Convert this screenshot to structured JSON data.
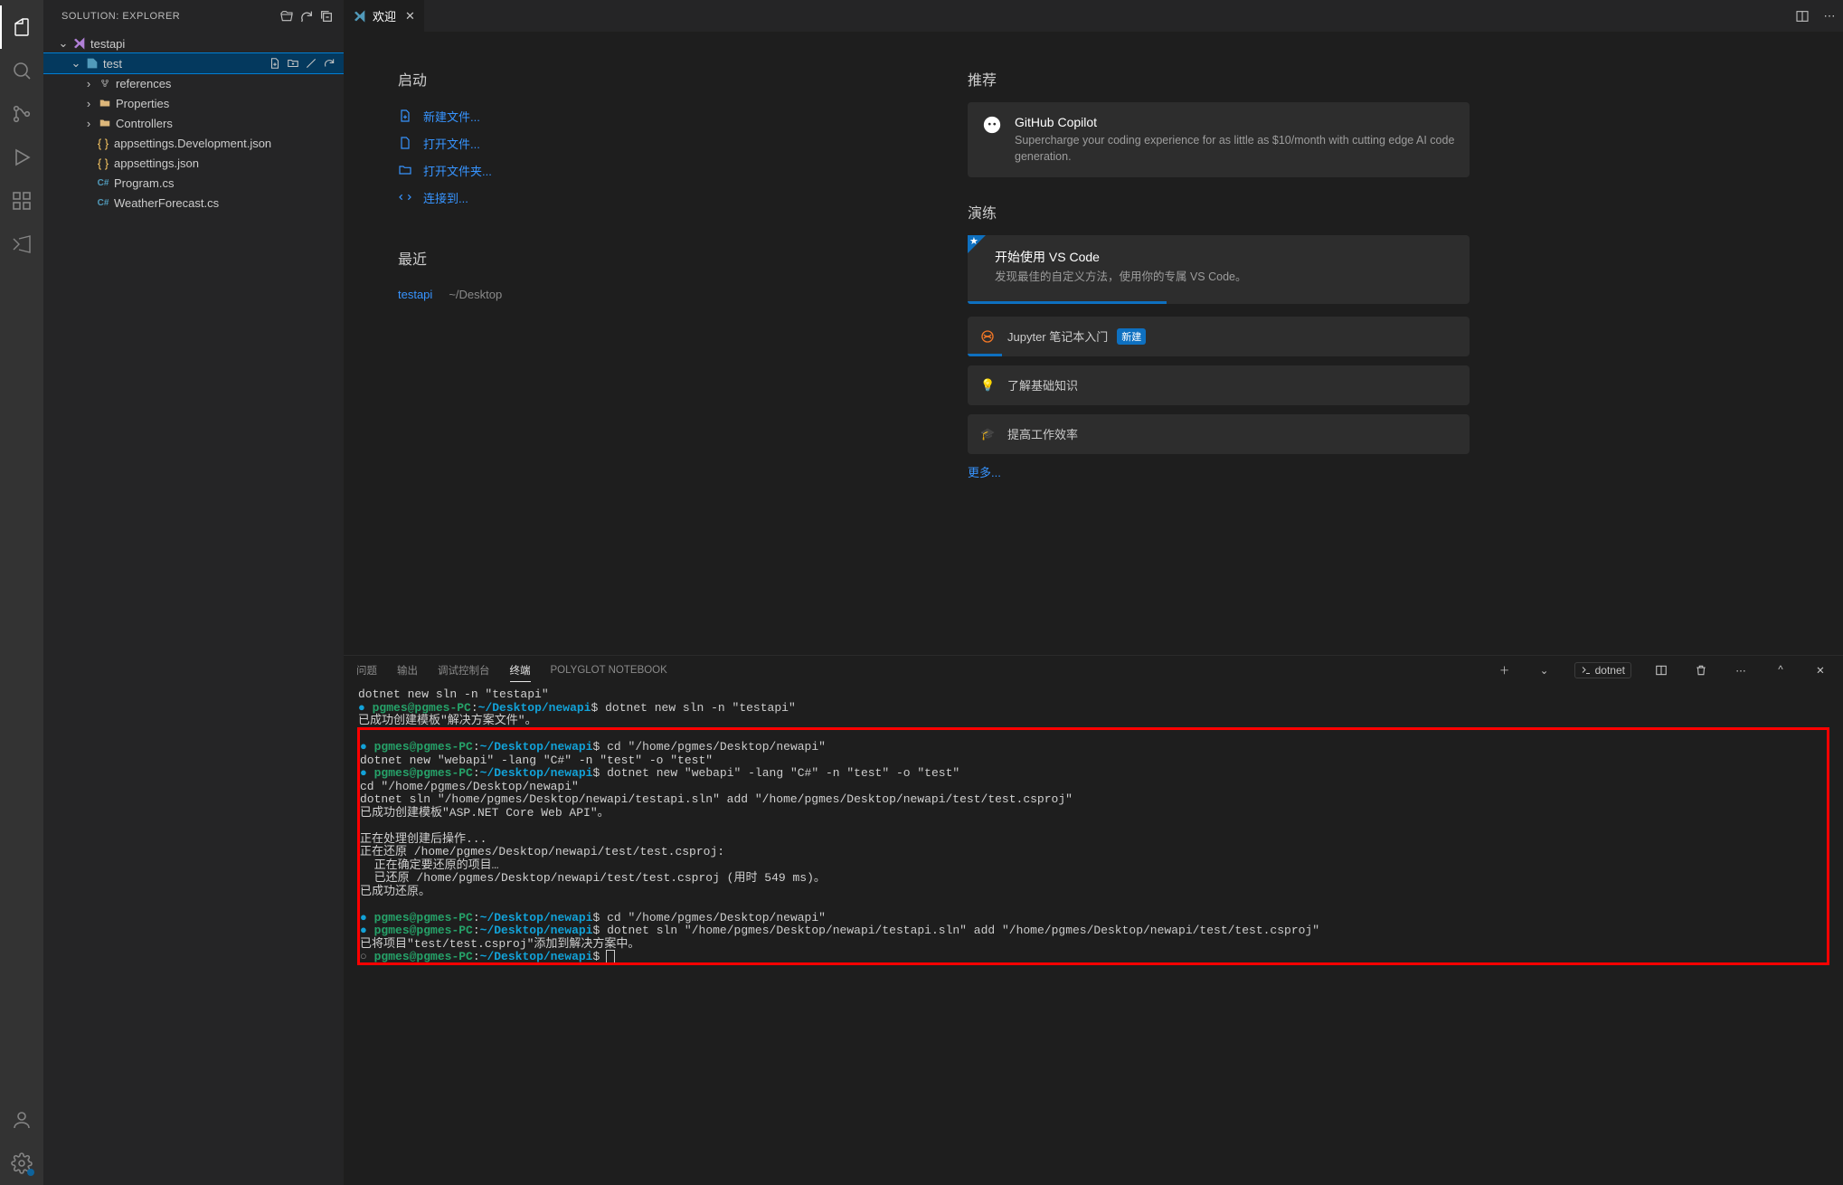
{
  "sidebar": {
    "title": "SOLUTION: EXPLORER",
    "root": "testapi",
    "project": "test",
    "items": [
      {
        "label": "references"
      },
      {
        "label": "Properties"
      },
      {
        "label": "Controllers"
      },
      {
        "label": "appsettings.Development.json"
      },
      {
        "label": "appsettings.json"
      },
      {
        "label": "Program.cs"
      },
      {
        "label": "WeatherForecast.cs"
      }
    ]
  },
  "tab": {
    "label": "欢迎"
  },
  "welcome": {
    "start_h": "启动",
    "start_links": [
      {
        "label": "新建文件..."
      },
      {
        "label": "打开文件..."
      },
      {
        "label": "打开文件夹..."
      },
      {
        "label": "连接到..."
      }
    ],
    "recent_h": "最近",
    "recent": {
      "name": "testapi",
      "path": "~/Desktop"
    },
    "recommend_h": "推荐",
    "copilot": {
      "title": "GitHub Copilot",
      "desc": "Supercharge your coding experience for as little as $10/month with cutting edge AI code generation."
    },
    "walk_h": "演练",
    "walk1": {
      "title": "开始使用 VS Code",
      "desc": "发现最佳的自定义方法，使用你的专属 VS Code。"
    },
    "walk2": {
      "label": "Jupyter 笔记本入门",
      "badge": "新建"
    },
    "walk3": {
      "label": "了解基础知识"
    },
    "walk4": {
      "label": "提高工作效率"
    },
    "more": "更多..."
  },
  "panel": {
    "tabs": [
      "问题",
      "输出",
      "调试控制台",
      "终端",
      "POLYGLOT NOTEBOOK"
    ],
    "profile": "dotnet"
  },
  "terminal": {
    "prompt_user": "pgmes@pgmes-PC",
    "prompt_sep": ":",
    "prompt_path": "~/Desktop/newapi",
    "prompt_end": "$",
    "l0": "dotnet new sln -n \"testapi\"",
    "cmd1": "dotnet new sln -n \"testapi\"",
    "l2": "已成功创建模板\"解决方案文件\"。",
    "cmd2": "cd \"/home/pgmes/Desktop/newapi\"",
    "l4": "dotnet new \"webapi\" -lang \"C#\" -n \"test\" -o \"test\"",
    "cmd3": "dotnet new \"webapi\" -lang \"C#\" -n \"test\" -o \"test\"",
    "l6": "cd \"/home/pgmes/Desktop/newapi\"",
    "l7": "dotnet sln \"/home/pgmes/Desktop/newapi/testapi.sln\" add \"/home/pgmes/Desktop/newapi/test/test.csproj\"",
    "l8": "已成功创建模板\"ASP.NET Core Web API\"。",
    "l9": "正在处理创建后操作...",
    "l10": "正在还原 /home/pgmes/Desktop/newapi/test/test.csproj:",
    "l11": "  正在确定要还原的项目…",
    "l12": "  已还原 /home/pgmes/Desktop/newapi/test/test.csproj (用时 549 ms)。",
    "l13": "已成功还原。",
    "cmd4": "cd \"/home/pgmes/Desktop/newapi\"",
    "cmd5": "dotnet sln \"/home/pgmes/Desktop/newapi/testapi.sln\" add \"/home/pgmes/Desktop/newapi/test/test.csproj\"",
    "l14": "已将项目\"test/test.csproj\"添加到解决方案中。"
  }
}
